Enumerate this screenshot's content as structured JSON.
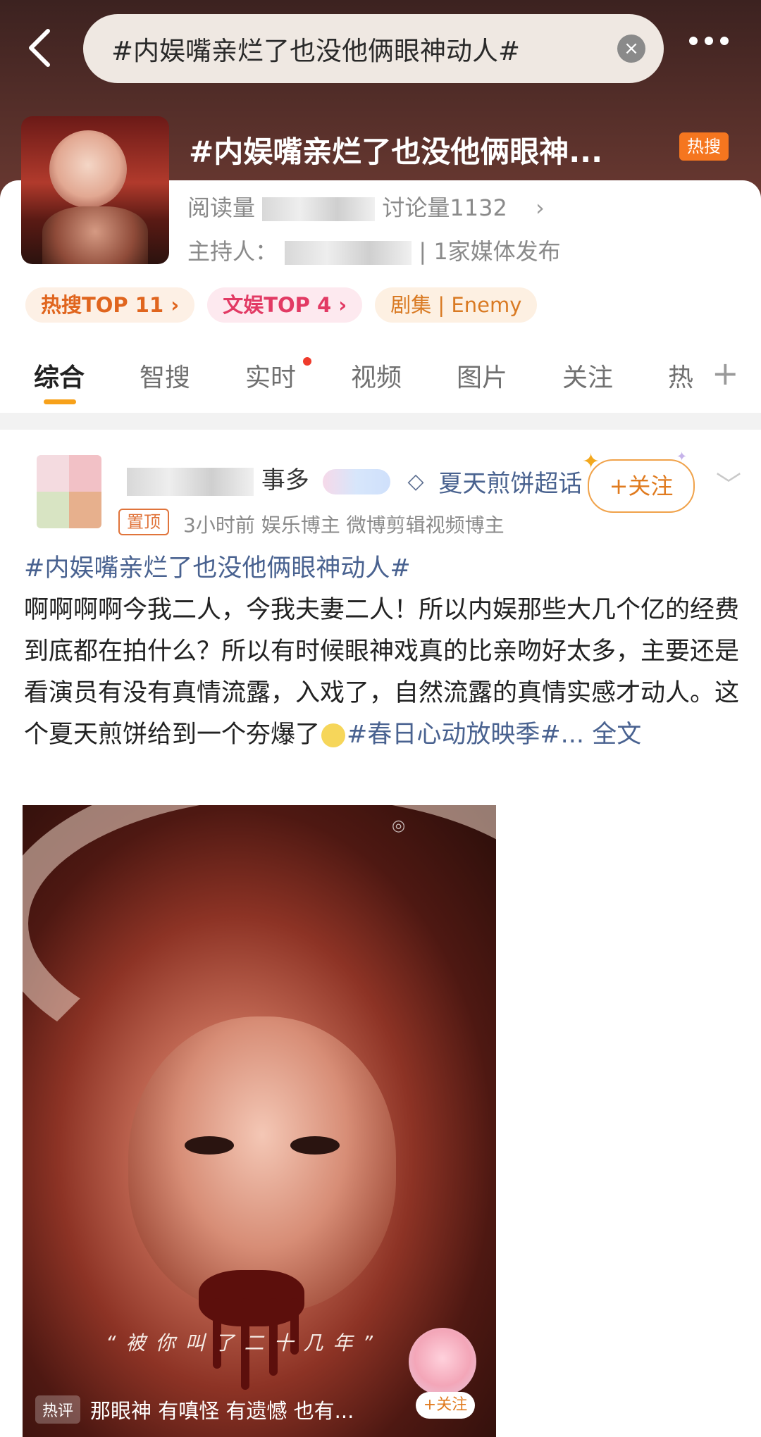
{
  "search": {
    "query": "#内娱嘴亲烂了也没他俩眼神动人#"
  },
  "topic": {
    "title": "#内娱嘴亲烂了也没他俩眼神...",
    "badge": "热搜",
    "stats_prefix": "阅读量",
    "stats_discuss": "讨论量1132",
    "host_prefix": "主持人：",
    "media": "| 1家媒体发布"
  },
  "chips": [
    "热搜TOP 11 ›",
    "文娱TOP 4 ›",
    "剧集 | Enemy"
  ],
  "tabs": [
    "综合",
    "智搜",
    "实时",
    "视频",
    "图片",
    "关注",
    "热"
  ],
  "post": {
    "user_suffix": "事多",
    "supertopic": "夏天煎饼超话",
    "follow": "+关注",
    "pinned": "置顶",
    "meta": "3小时前   娱乐博主  微博剪辑视频博主",
    "tag_head": "#内娱嘴亲烂了也没他俩眼神动人#",
    "body": "啊啊啊啊今我二人，今我夫妻二人！所以内娱那些大几个亿的经费到底都在拍什么？所以有时候眼神戏真的比亲吻好太多，主要还是看演员有没有真情流露，入戏了，自然流露的真情实感才动人。这个夏天煎饼给到一个夯爆了",
    "tag_tail": "#春日心动放映季#...",
    "full_text": "全文"
  },
  "media": {
    "caption": "“被你叫了二十几年”",
    "hot_comment_label": "热评",
    "hot_comment": "那眼神 有嗔怪 有遗憾 也有...",
    "sticker_follow": "+关注"
  },
  "colors": {
    "accent": "#f7a11a",
    "link": "#496290",
    "hot_badge": "#f5761f"
  },
  "icons": [
    "back-icon",
    "clear-icon",
    "more-icon",
    "chevron-right-icon",
    "plus-icon",
    "chevron-down-icon",
    "diamond-icon"
  ]
}
